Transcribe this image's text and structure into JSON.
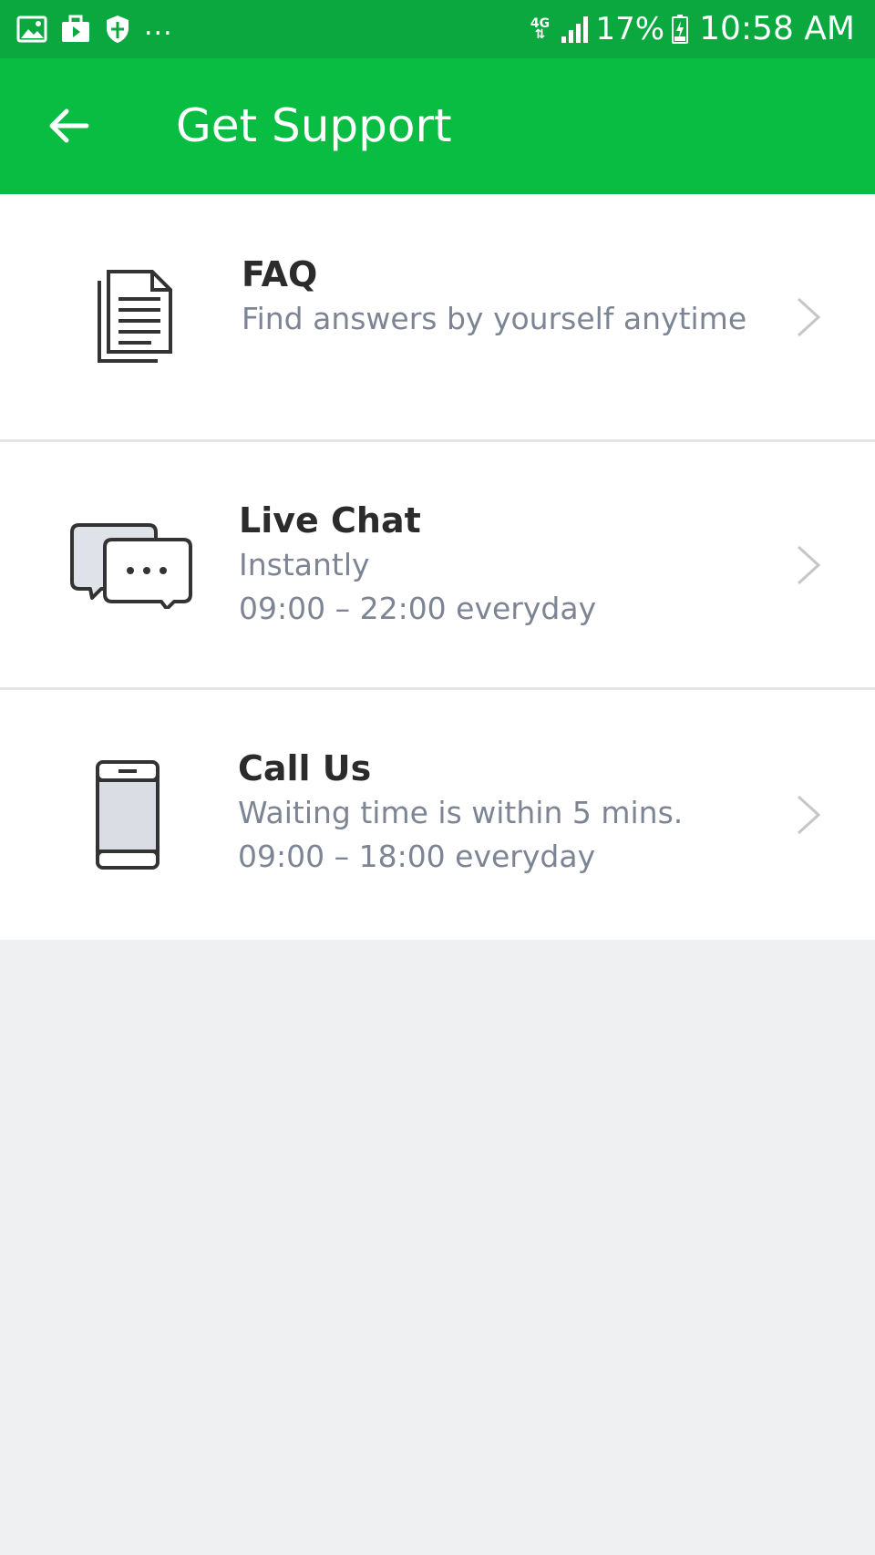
{
  "status_bar": {
    "network": "4G",
    "battery": "17%",
    "time": "10:58 AM",
    "more": "..."
  },
  "header": {
    "title": "Get Support",
    "background": "#08bd42"
  },
  "options": [
    {
      "title": "FAQ",
      "lines": [
        "Find answers by yourself anytime"
      ],
      "icon": "document-icon"
    },
    {
      "title": "Live Chat",
      "lines": [
        "Instantly",
        "09:00 – 22:00 everyday"
      ],
      "icon": "chat-bubbles-icon"
    },
    {
      "title": "Call Us",
      "lines": [
        "Waiting time is within 5 mins.",
        "09:00 – 18:00 everyday"
      ],
      "icon": "phone-icon"
    }
  ]
}
